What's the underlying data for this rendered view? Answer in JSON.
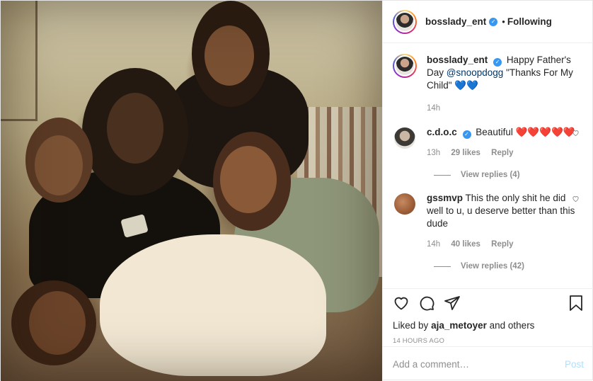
{
  "post": {
    "author": "bosslady_ent",
    "follow_status": "Following",
    "separator": "•",
    "verified_mark": "✓"
  },
  "caption": {
    "username": "bosslady_ent",
    "text_before": "Happy Father's Day",
    "mention": "@snoopdogg",
    "text_after": "\"Thanks For My Child\"",
    "emoji": "💙💙",
    "time": "14h"
  },
  "comments": [
    {
      "username": "c.d.o.c",
      "verified": true,
      "text": "Beautiful",
      "emoji": "❤️❤️❤️❤️❤️",
      "time": "13h",
      "likes": "29 likes",
      "reply_label": "Reply",
      "view_replies": "View replies (4)"
    },
    {
      "username": "gssmvp",
      "verified": false,
      "text": "This the only shit he did well to u, u deserve better than this dude",
      "time": "14h",
      "likes": "40 likes",
      "reply_label": "Reply",
      "view_replies": "View replies (42)"
    }
  ],
  "likes_line": {
    "prefix": "Liked by",
    "user": "aja_metoyer",
    "suffix": "and others"
  },
  "timestamp": "14 HOURS AGO",
  "add_comment": {
    "placeholder": "Add a comment…",
    "post_label": "Post"
  },
  "icons": {
    "like": "heart-outline-icon",
    "comment": "comment-bubble-icon",
    "share": "paper-plane-icon",
    "save": "bookmark-icon",
    "comment_like": "small-heart-icon"
  },
  "colors": {
    "verified": "#3897f0",
    "link": "#003569",
    "muted": "#8e8e8e",
    "post_button": "#b2dffc"
  }
}
